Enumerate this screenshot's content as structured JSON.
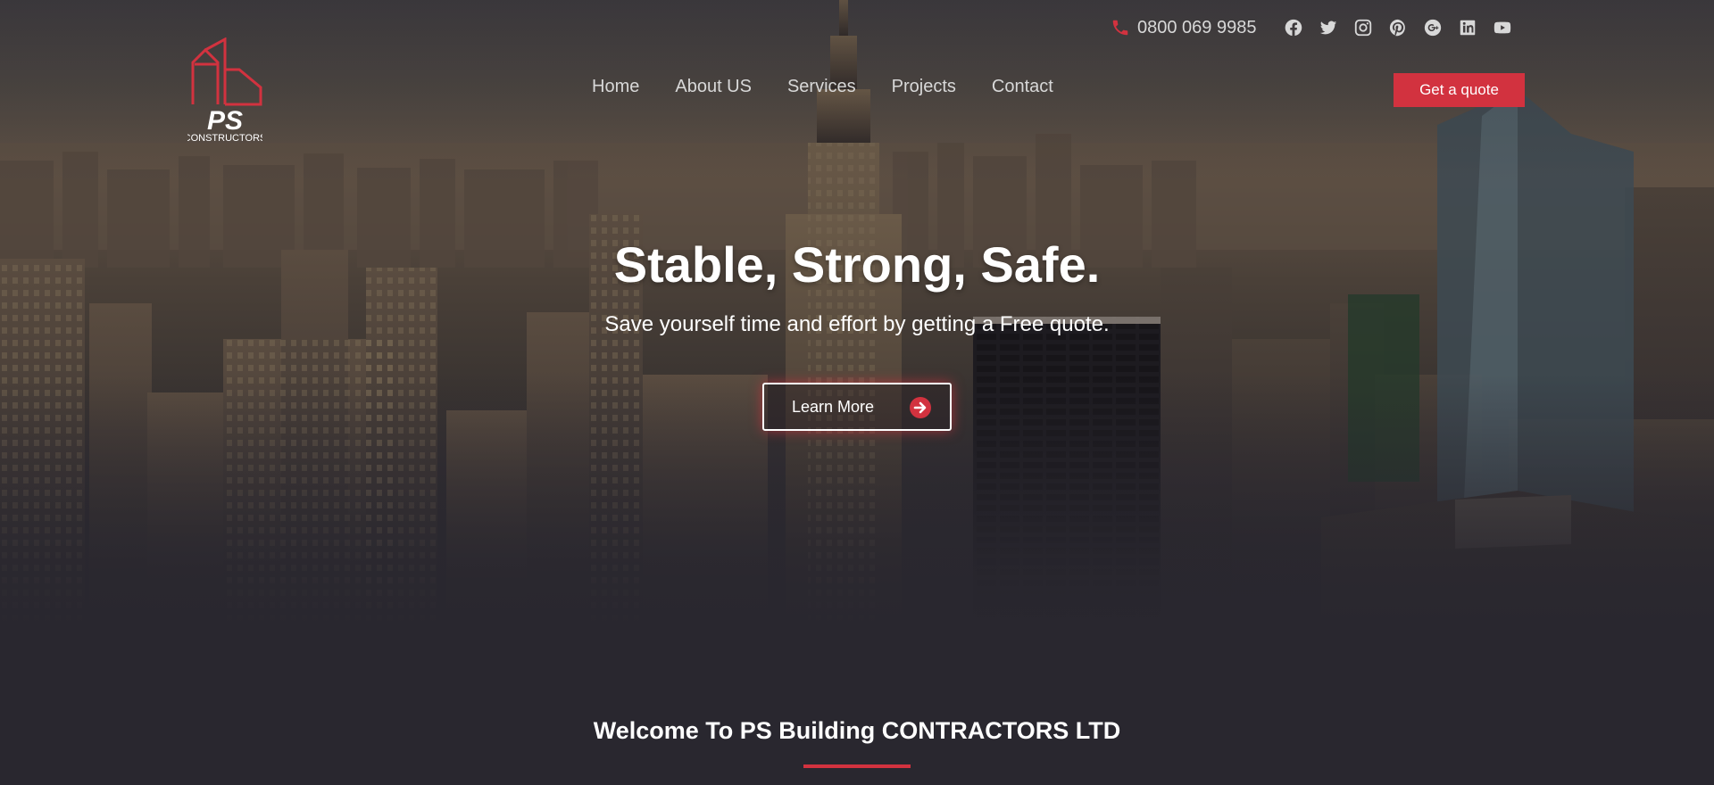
{
  "header": {
    "phone": "0800 069 9985",
    "social": [
      "facebook-icon",
      "twitter-icon",
      "instagram-icon",
      "pinterest-icon",
      "google-plus-icon",
      "linkedin-icon",
      "youtube-icon"
    ],
    "logo": {
      "initials": "PS",
      "wordmark": "CONSTRUCTORS"
    },
    "nav": [
      "Home",
      "About US",
      "Services",
      "Projects",
      "Contact"
    ],
    "cta": "Get a quote"
  },
  "hero": {
    "title": "Stable, Strong, Safe.",
    "subtitle": "Save yourself time and effort by getting a Free quote.",
    "button": "Learn More"
  },
  "welcome": {
    "title": "Welcome To PS Building CONTRACTORS LTD"
  },
  "colors": {
    "accent": "#d2323f",
    "background": "#29272f",
    "text": "#ffffff",
    "muted": "#d8d8d8"
  }
}
